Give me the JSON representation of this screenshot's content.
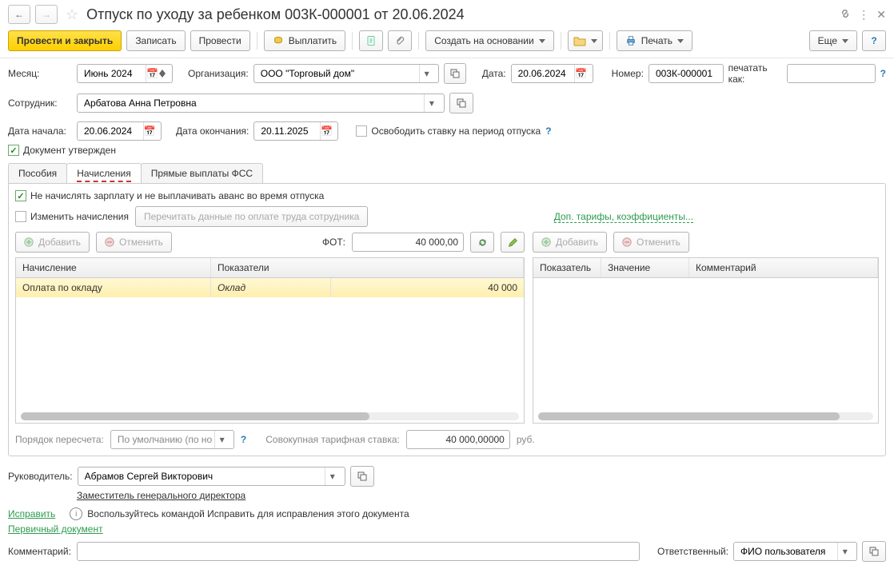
{
  "header": {
    "title": "Отпуск по уходу за ребенком 003К-000001 от 20.06.2024"
  },
  "toolbar": {
    "post_and_close": "Провести и закрыть",
    "write": "Записать",
    "post": "Провести",
    "pay": "Выплатить",
    "create_based": "Создать на основании",
    "print": "Печать",
    "more": "Еще"
  },
  "fields": {
    "month_lbl": "Месяц:",
    "month_val": "Июнь 2024",
    "org_lbl": "Организация:",
    "org_val": "ООО \"Торговый дом\"",
    "date_lbl": "Дата:",
    "date_val": "20.06.2024",
    "number_lbl": "Номер:",
    "number_val": "003К-000001",
    "print_as_lbl": "печатать как:",
    "employee_lbl": "Сотрудник:",
    "employee_val": "Арбатова Анна Петровна",
    "date_start_lbl": "Дата начала:",
    "date_start_val": "20.06.2024",
    "date_end_lbl": "Дата окончания:",
    "date_end_val": "20.11.2025",
    "free_rate_lbl": "Освободить ставку на период отпуска",
    "approved_lbl": "Документ утвержден"
  },
  "tabs": {
    "benefits": "Пособия",
    "accruals": "Начисления",
    "fss": "Прямые выплаты ФСС"
  },
  "panel": {
    "no_pay_lbl": "Не начислять зарплату и не выплачивать аванс во время отпуска",
    "change_accruals_lbl": "Изменить начисления",
    "reread_btn": "Перечитать данные по оплате труда сотрудника",
    "tariffs_link": "Доп. тарифы, коэффициенты...",
    "add": "Добавить",
    "cancel": "Отменить",
    "fot_lbl": "ФОТ:",
    "fot_val": "40 000,00",
    "table_left_cols": [
      "Начисление",
      "Показатели"
    ],
    "table_left_row": {
      "name": "Оплата по окладу",
      "ind": "Оклад",
      "val": "40 000"
    },
    "table_right_cols": [
      "Показатель",
      "Значение",
      "Комментарий"
    ],
    "recalc_order_lbl": "Порядок пересчета:",
    "recalc_order_val": "По умолчанию (по норм",
    "total_rate_lbl": "Совокупная тарифная ставка:",
    "total_rate_val": "40 000,00000",
    "rub": "руб."
  },
  "footer": {
    "head_lbl": "Руководитель:",
    "head_val": "Абрамов Сергей Викторович",
    "position": "Заместитель генерального директора",
    "fix_link": "Исправить",
    "fix_hint": "Воспользуйтесь командой Исправить для исправления этого документа",
    "primary_doc": "Первичный документ",
    "comment_lbl": "Комментарий:",
    "resp_lbl": "Ответственный:",
    "resp_val": "ФИО пользователя"
  }
}
